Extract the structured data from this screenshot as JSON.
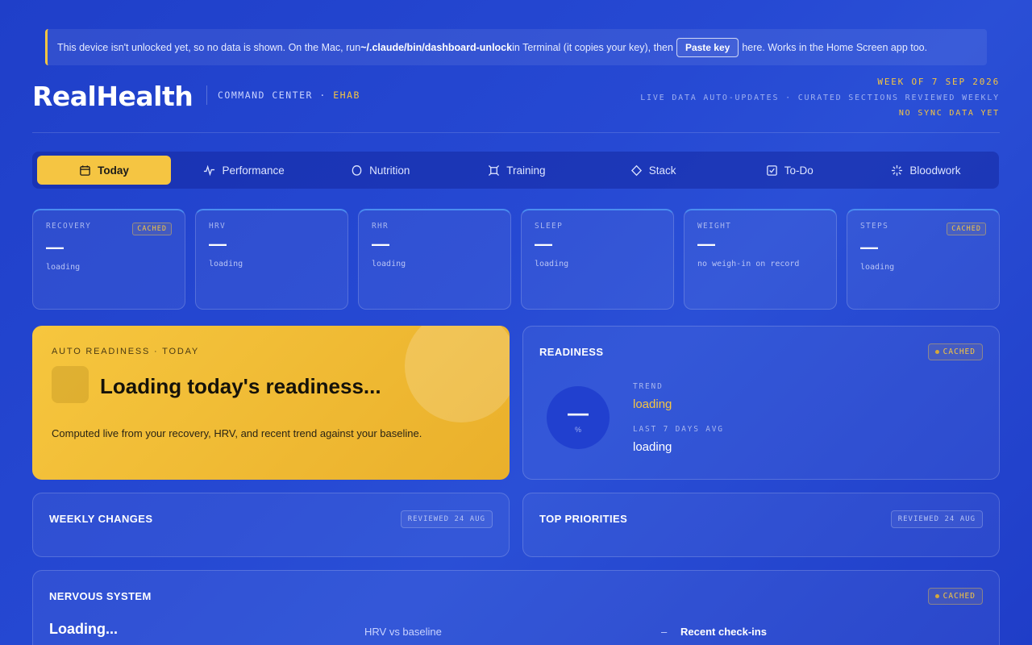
{
  "banner": {
    "text_before": "This device isn't unlocked yet, so no data is shown. On the Mac, run ",
    "command": "~/.claude/bin/dashboard-unlock",
    "text_middle": " in Terminal (it copies your key), then ",
    "paste_label": "Paste key",
    "text_after": " here. Works in the Home Screen app too."
  },
  "header": {
    "logo": "RealHealth",
    "section": "COMMAND CENTER",
    "separator": "·",
    "user": "EHAB",
    "week": "WEEK OF 7 SEP 2026",
    "live": "LIVE DATA AUTO-UPDATES · CURATED SECTIONS REVIEWED WEEKLY",
    "sync": "NO SYNC DATA YET"
  },
  "tabs": [
    {
      "label": "Today",
      "icon": "calendar-icon",
      "active": true
    },
    {
      "label": "Performance",
      "icon": "activity-icon"
    },
    {
      "label": "Nutrition",
      "icon": "shield-icon"
    },
    {
      "label": "Training",
      "icon": "frame-icon"
    },
    {
      "label": "Stack",
      "icon": "diamond-icon"
    },
    {
      "label": "To-Do",
      "icon": "checkbox-icon"
    },
    {
      "label": "Bloodwork",
      "icon": "sparkle-icon"
    }
  ],
  "stats": [
    {
      "label": "RECOVERY",
      "value": "—",
      "sub": "loading",
      "badge": "CACHED"
    },
    {
      "label": "HRV",
      "value": "—",
      "sub": "loading"
    },
    {
      "label": "RHR",
      "value": "—",
      "sub": "loading"
    },
    {
      "label": "SLEEP",
      "value": "—",
      "sub": "loading"
    },
    {
      "label": "WEIGHT",
      "value": "—",
      "sub": "no weigh-in on record"
    },
    {
      "label": "STEPS",
      "value": "—",
      "sub": "loading",
      "badge": "CACHED"
    }
  ],
  "auto_readiness": {
    "kicker": "AUTO READINESS · TODAY",
    "title": "Loading today's readiness...",
    "description": "Computed live from your recovery, HRV, and recent trend against your baseline."
  },
  "readiness": {
    "title": "READINESS",
    "badge": "CACHED",
    "value": "—",
    "unit": "%",
    "trend_label": "TREND",
    "trend_value": "loading",
    "avg_label": "LAST 7 DAYS AVG",
    "avg_value": "loading"
  },
  "weekly_changes": {
    "title": "WEEKLY CHANGES",
    "badge": "REVIEWED 24 AUG"
  },
  "top_priorities": {
    "title": "TOP PRIORITIES",
    "badge": "REVIEWED 24 AUG"
  },
  "nervous_system": {
    "title": "NERVOUS SYSTEM",
    "badge": "CACHED",
    "loading": "Loading...",
    "hrv_label": "HRV vs baseline",
    "dash": "–",
    "recent_label": "Recent check-ins"
  },
  "colors": {
    "accent": "#f5c542",
    "background": "#2547d2",
    "stat_top": "#4a8ef0"
  }
}
